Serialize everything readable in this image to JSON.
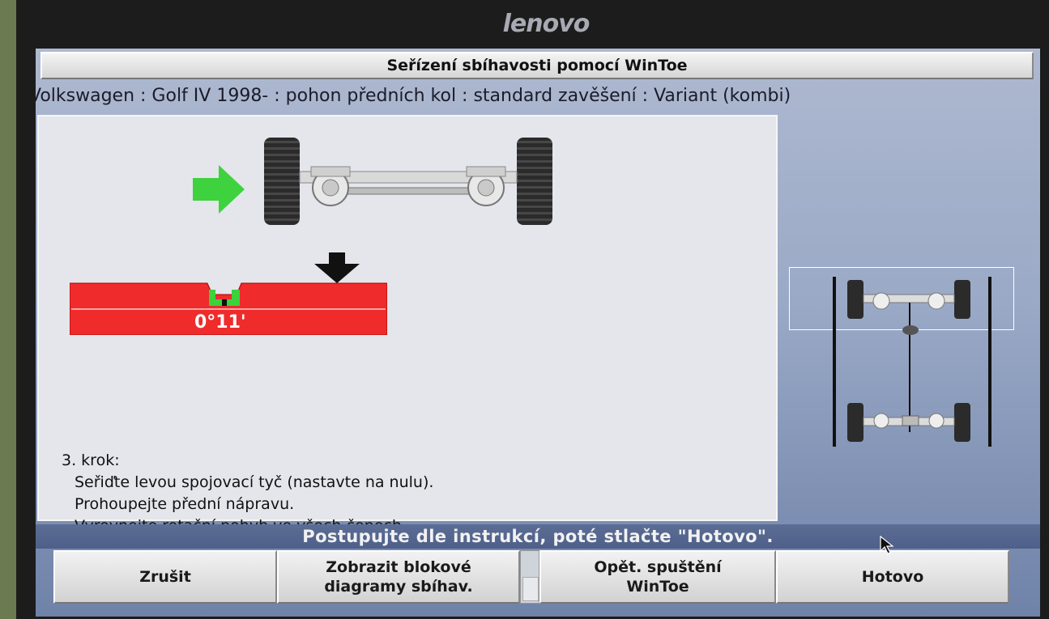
{
  "monitor": {
    "brand": "lenovo"
  },
  "window": {
    "title": "Seřízení sbíhavosti pomocí WinToe"
  },
  "vehicle": {
    "description": "Volkswagen : Golf IV 1998- : pohon předních kol : standard zavěšení : Variant (kombi)"
  },
  "gauge": {
    "reading": "0°11'",
    "color": "#ef2b2b",
    "indicator_color": "#3bd23b"
  },
  "instructions": {
    "step": "3. krok:",
    "lines": [
      "Seřiďte levou spojovací tyč (nastavte na nulu).",
      "Prohoupejte přední nápravu.",
      "Vyrovnejte rotační pohyb ve všech čepech."
    ]
  },
  "status": {
    "message": "Postupujte dle instrukcí, poté stlačte \"Hotovo\"."
  },
  "buttons": {
    "cancel": "Zrušit",
    "show_diagrams": "Zobrazit blokové\ndiagramy sbíhav.",
    "restart": "Opět. spuštění\nWinToe",
    "done": "Hotovo"
  },
  "icons": [
    "green-arrow-icon",
    "black-down-arrow-icon",
    "cursor-icon"
  ]
}
